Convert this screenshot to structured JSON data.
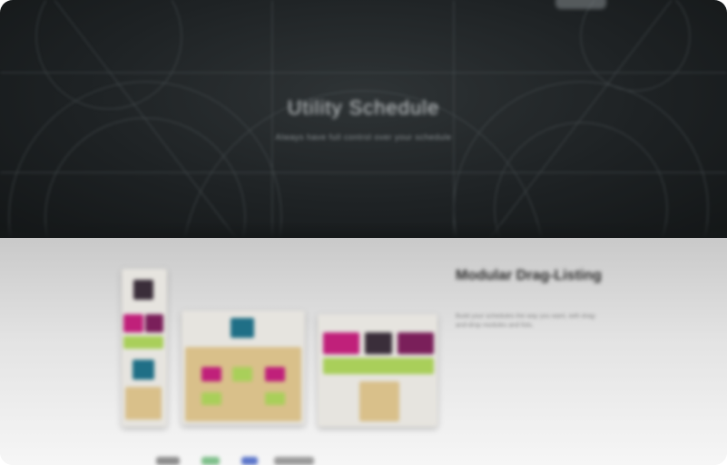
{
  "hero": {
    "title": "Utility Schedule",
    "subtitle": "Always have full control over your schedule"
  },
  "feature": {
    "title": "Modular Drag-Listing",
    "description": "Build your schedules the way you want, with drag-and-drop modules and lists."
  },
  "colors": {
    "hero_bg": "#1e2224",
    "magenta": "#c0207a",
    "teal": "#1f6f86",
    "lime": "#a9cf5a",
    "sand": "#d9c08a",
    "charcoal": "#3a2e3a"
  }
}
